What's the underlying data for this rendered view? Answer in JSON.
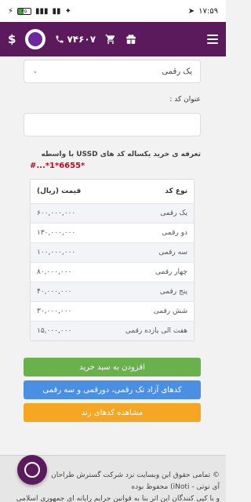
{
  "status_bar": {
    "time": "۱۷:۵۹",
    "battery": "۴۵"
  },
  "header": {
    "currency_icon": "$",
    "phone": "۷۴۶۰۷",
    "brand_color": "#5a1a5c"
  },
  "form": {
    "select_value": "یک رقمی",
    "title_label": "عنوان کد :",
    "title_value": ""
  },
  "tariff": {
    "title": "تعرفه ی خرید یکساله کد های USSD با واسطه",
    "ussd_code": "#...*1*6655*",
    "table": {
      "headers": [
        "نوع کد",
        "قیمت (ریال)"
      ],
      "rows": [
        {
          "name": "یک رقمی",
          "price": "۶۰۰,۰۰۰,۰۰۰"
        },
        {
          "name": "دو رقمی",
          "price": "۱۳۰,۰۰۰,۰۰۰"
        },
        {
          "name": "سه رقمی",
          "price": "۱۰۰,۰۰۰,۰۰۰"
        },
        {
          "name": "چهار رقمی",
          "price": "۸۰,۰۰۰,۰۰۰"
        },
        {
          "name": "پنج رقمی",
          "price": "۴۰,۰۰۰,۰۰۰"
        },
        {
          "name": "شش رقمی",
          "price": "۳۰,۰۰۰,۰۰۰"
        },
        {
          "name": "هفت الی یازده رقمی",
          "price": "۱۵,۰۰۰,۰۰۰"
        }
      ]
    }
  },
  "buttons": {
    "add_to_cart": "افزودن به سبد خرید",
    "free_codes": "کدهای آزاد تک رقمی، دورقمی و سه رقمی",
    "view_ranked": "مشاهده کدهای رند",
    "colors": {
      "green": "#6ab04c",
      "blue": "#4b8fe2",
      "orange": "#f5a623"
    }
  },
  "footer": {
    "line1": "© تمامی حقوق این وبسایت نزد شرکت گسترش طراحان",
    "line2": "آی نوتی - iNoti) محفوظ بوده",
    "line3": "و با کپی کنندگان این اثر بنا به قوانین جرایم رایانه ای جمهوری اسلامی"
  }
}
